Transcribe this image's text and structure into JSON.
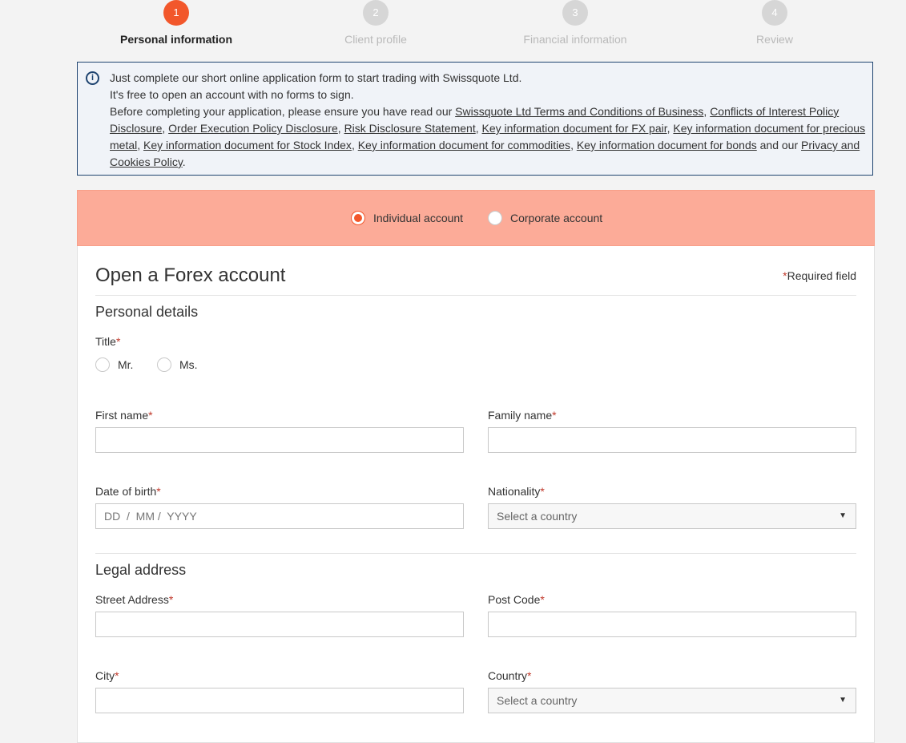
{
  "stepper": {
    "steps": [
      {
        "number": "1",
        "label": "Personal information"
      },
      {
        "number": "2",
        "label": "Client profile"
      },
      {
        "number": "3",
        "label": "Financial information"
      },
      {
        "number": "4",
        "label": "Review"
      }
    ]
  },
  "info": {
    "icon": "info-icon",
    "line1": "Just complete our short online application form to start trading with Swissquote Ltd.",
    "line2": "It's free to open an account with no forms to sign.",
    "intro": "Before completing your application, please ensure you have read our ",
    "links": [
      "Swissquote Ltd Terms and Conditions of Business",
      "Conflicts of Interest Policy Disclosure",
      "Order Execution Policy Disclosure",
      "Risk Disclosure Statement",
      "Key information document for FX pair",
      "Key information document for precious metal",
      "Key information document for Stock Index",
      "Key information document for commodities",
      "Key information document for bonds",
      "Privacy and Cookies Policy"
    ],
    "separator": ", ",
    "and_our": " and our ",
    "end": "."
  },
  "account_type": {
    "individual": "Individual account",
    "corporate": "Corporate account",
    "selected": "individual",
    "accent_color": "#f2572b"
  },
  "form": {
    "title": "Open a Forex account",
    "required_star": "*",
    "required_note": "Required field",
    "personal_details": {
      "heading": "Personal details",
      "title_label": "Title",
      "title_options": [
        "Mr.",
        "Ms."
      ],
      "first_name_label": "First name",
      "family_name_label": "Family name",
      "dob_label": "Date of birth",
      "dob_placeholder": "DD  /  MM /  YYYY",
      "nationality_label": "Nationality",
      "nationality_value": "Select a country"
    },
    "legal_address": {
      "heading": "Legal address",
      "street_label": "Street Address",
      "post_code_label": "Post Code",
      "city_label": "City",
      "country_label": "Country",
      "country_value": "Select a country"
    }
  }
}
